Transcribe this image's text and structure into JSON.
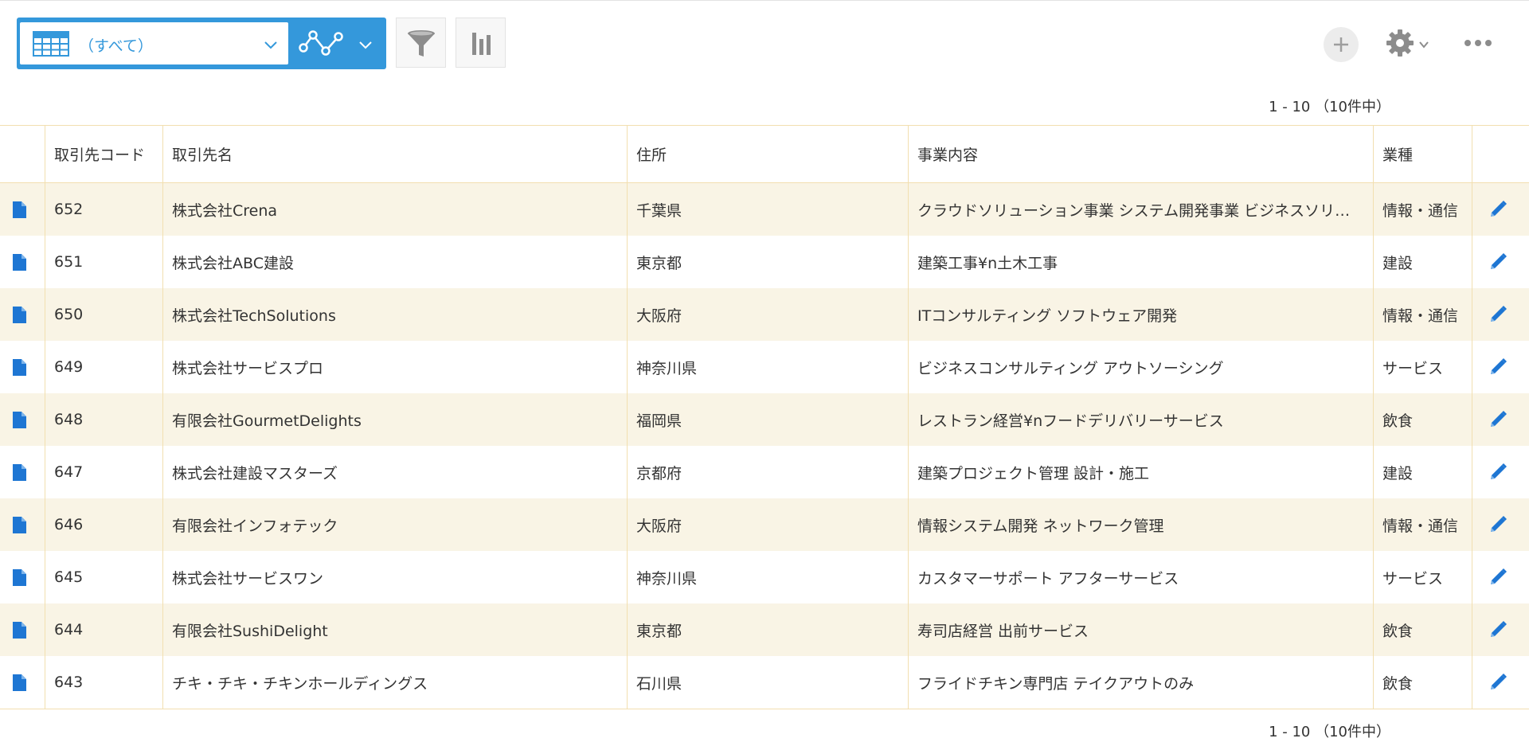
{
  "toolbar": {
    "view_label": "（すべて）",
    "colors": {
      "accent": "#3498db",
      "button_bg": "#f7f7f7",
      "row_alt": "#f9f4e5",
      "border": "#f2dfb0"
    },
    "icons": [
      "table-icon",
      "chevron-down-icon",
      "graph-icon",
      "filter-icon",
      "bar-chart-icon",
      "plus-icon",
      "gear-icon",
      "more-icon"
    ]
  },
  "pager": {
    "top": "1 - 10 （10件中）",
    "bottom": "1 - 10 （10件中）"
  },
  "table": {
    "headers": {
      "code": "取引先コード",
      "name": "取引先名",
      "address": "住所",
      "business": "事業内容",
      "industry": "業種"
    },
    "rows": [
      {
        "code": "652",
        "name": "株式会社Crena",
        "address": "千葉県",
        "business": "クラウドソリューション事業 システム開発事業 ビジネスソリ…",
        "industry": "情報・通信"
      },
      {
        "code": "651",
        "name": "株式会社ABC建設",
        "address": "東京都",
        "business": "建築工事¥n土木工事",
        "industry": "建設"
      },
      {
        "code": "650",
        "name": "株式会社TechSolutions",
        "address": "大阪府",
        "business": "ITコンサルティング ソフトウェア開発",
        "industry": "情報・通信"
      },
      {
        "code": "649",
        "name": "株式会社サービスプロ",
        "address": "神奈川県",
        "business": "ビジネスコンサルティング アウトソーシング",
        "industry": "サービス"
      },
      {
        "code": "648",
        "name": "有限会社GourmetDelights",
        "address": "福岡県",
        "business": "レストラン経営¥nフードデリバリーサービス",
        "industry": "飲食"
      },
      {
        "code": "647",
        "name": "株式会社建設マスターズ",
        "address": "京都府",
        "business": "建築プロジェクト管理 設計・施工",
        "industry": "建設"
      },
      {
        "code": "646",
        "name": "有限会社インフォテック",
        "address": "大阪府",
        "business": "情報システム開発 ネットワーク管理",
        "industry": "情報・通信"
      },
      {
        "code": "645",
        "name": "株式会社サービスワン",
        "address": "神奈川県",
        "business": "カスタマーサポート アフターサービス",
        "industry": "サービス"
      },
      {
        "code": "644",
        "name": "有限会社SushiDelight",
        "address": "東京都",
        "business": "寿司店経営 出前サービス",
        "industry": "飲食"
      },
      {
        "code": "643",
        "name": "チキ・チキ・チキンホールディングス",
        "address": "石川県",
        "business": "フライドチキン専門店 テイクアウトのみ",
        "industry": "飲食"
      }
    ]
  }
}
